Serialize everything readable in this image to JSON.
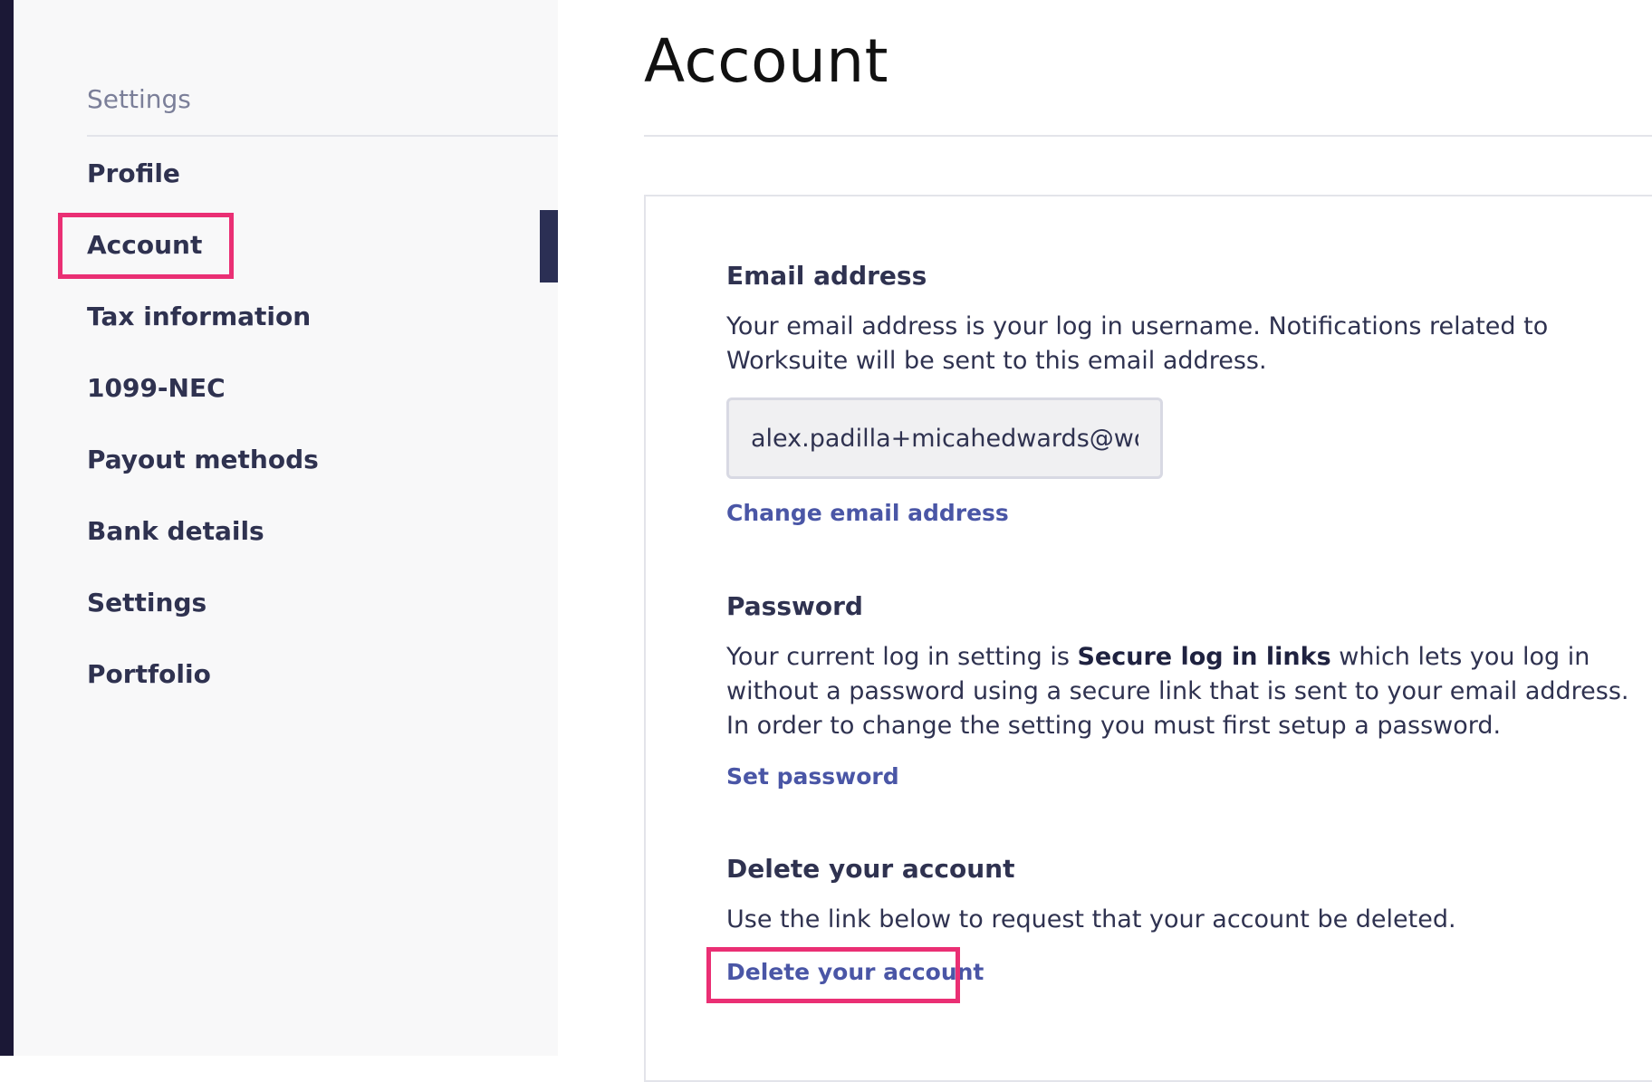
{
  "sidebar": {
    "heading": "Settings",
    "items": [
      {
        "label": "Profile"
      },
      {
        "label": "Account"
      },
      {
        "label": "Tax information"
      },
      {
        "label": "1099-NEC"
      },
      {
        "label": "Payout methods"
      },
      {
        "label": "Bank details"
      },
      {
        "label": "Settings"
      },
      {
        "label": "Portfolio"
      }
    ],
    "active_item": "Account"
  },
  "main": {
    "title": "Account",
    "email_section": {
      "heading": "Email address",
      "description_line1": "Your email address is your log in username. Notifications related to",
      "description_line2": "Worksuite will be sent to this email address.",
      "email_value": "alex.padilla+micahedwards@worksuite.com",
      "change_link": "Change email address"
    },
    "password_section": {
      "heading": "Password",
      "description_line1_prefix": "Your current log in setting is ",
      "description_line1_bold": "Secure log in links",
      "description_line1_suffix": " which lets you log in",
      "description_line2": "without a password using a secure link that is sent to your email address.",
      "description_line3": "In order to change the setting you must first setup a password.",
      "set_password_link": "Set password"
    },
    "delete_section": {
      "heading": "Delete your account",
      "description": "Use the link below to request that your account be deleted.",
      "delete_link": "Delete your account"
    }
  },
  "colors": {
    "rail": "#1b1836",
    "sidebar_bg": "#f8f8f9",
    "text": "#2f3250",
    "link": "#4a56a6",
    "highlight": "#ea2f74",
    "active_indicator": "#2b2f54"
  }
}
